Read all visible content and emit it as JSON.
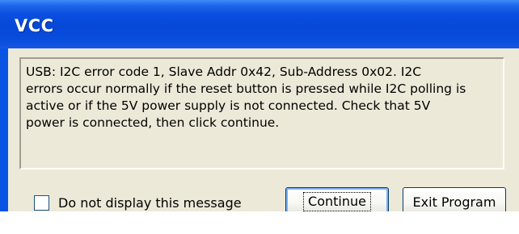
{
  "window": {
    "title": "VCC"
  },
  "message": {
    "line1": "USB: I2C error code 1, Slave Addr 0x42, Sub-Address 0x02.  I2C",
    "line2": "errors occur normally if the reset button is pressed while I2C polling is",
    "line3": "active or if the 5V power supply is not connected.  Check that 5V",
    "line4": "power is connected, then click continue."
  },
  "checkbox": {
    "label": "Do not display this message",
    "checked": false
  },
  "buttons": {
    "continue_label": "Continue",
    "exit_label": "Exit Program"
  },
  "colors": {
    "title_bar": "#0a54e3",
    "dialog_face": "#ece9d8",
    "button_border": "#003c74"
  }
}
